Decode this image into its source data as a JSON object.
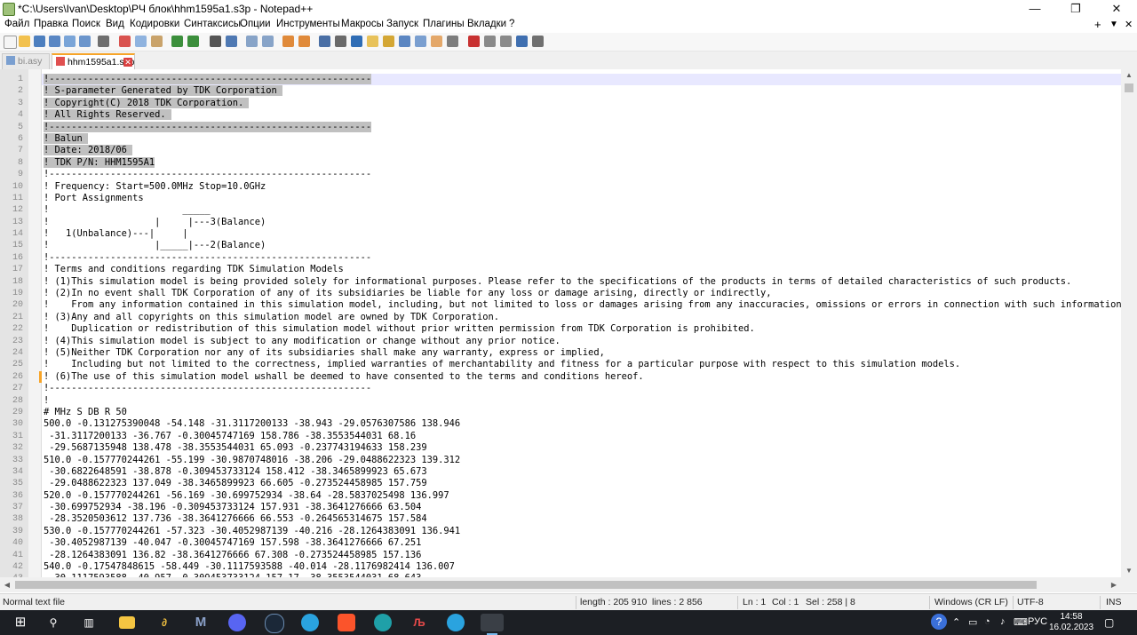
{
  "window": {
    "title": "*C:\\Users\\Ivan\\Desktop\\РЧ блок\\hhm1595a1.s3p - Notepad++",
    "minimize": "—",
    "maximize": "❐",
    "close": "✕"
  },
  "menu": {
    "items": [
      "Файл",
      "Правка",
      "Поиск",
      "Вид",
      "Кодировки",
      "Синтаксисы",
      "Опции",
      "Инструменты",
      "Макросы",
      "Запуск",
      "Плагины",
      "Вкладки",
      "?"
    ],
    "right_plus": "+",
    "right_arrow": "▼",
    "right_close": "✕"
  },
  "tabs": [
    {
      "label": "bi.asy"
    },
    {
      "label": "hhm1595a1.s3p",
      "close": "✕"
    }
  ],
  "editor": {
    "lines": [
      {
        "n": "1",
        "text": "!----------------------------------------------------------",
        "sel": true
      },
      {
        "n": "2",
        "text": "! S-parameter Generated by TDK Corporation ",
        "sel": true
      },
      {
        "n": "3",
        "text": "! Copyright(C) 2018 TDK Corporation. ",
        "sel": true
      },
      {
        "n": "4",
        "text": "! All Rights Reserved. ",
        "sel": true
      },
      {
        "n": "5",
        "text": "!----------------------------------------------------------",
        "sel": true
      },
      {
        "n": "6",
        "text": "! Balun ",
        "sel": true
      },
      {
        "n": "7",
        "text": "! Date: 2018/06 ",
        "sel": true
      },
      {
        "n": "8",
        "text": "! TDK P/N: HHM1595A1",
        "sel": true
      },
      {
        "n": "9",
        "text": "!----------------------------------------------------------"
      },
      {
        "n": "10",
        "text": "! Frequency: Start=500.0MHz Stop=10.0GHz"
      },
      {
        "n": "11",
        "text": "! Port Assignments"
      },
      {
        "n": "12",
        "text": "!                        _____"
      },
      {
        "n": "13",
        "text": "!                   |     |---3(Balance)"
      },
      {
        "n": "14",
        "text": "!   1(Unbalance)---|     |"
      },
      {
        "n": "15",
        "text": "!                   |_____|---2(Balance)"
      },
      {
        "n": "16",
        "text": "!----------------------------------------------------------"
      },
      {
        "n": "17",
        "text": "! Terms and conditions regarding TDK Simulation Models"
      },
      {
        "n": "18",
        "text": "! (1)This simulation model is being provided solely for informational purposes. Please refer to the specifications of the products in terms of detailed characteristics of such products."
      },
      {
        "n": "19",
        "text": "! (2)In no event shall TDK Corporation of any of its subsidiaries be liable for any loss or damage arising, directly or indirectly,"
      },
      {
        "n": "20",
        "text": "!    From any information contained in this simulation model, including, but not limited to loss or damages arising from any inaccuracies, omissions or errors in connection with such information."
      },
      {
        "n": "21",
        "text": "! (3)Any and all copyrights on this simulation model are owned by TDK Corporation."
      },
      {
        "n": "22",
        "text": "!    Duplication or redistribution of this simulation model without prior written permission from TDK Corporation is prohibited."
      },
      {
        "n": "23",
        "text": "! (4)This simulation model is subject to any modification or change without any prior notice."
      },
      {
        "n": "24",
        "text": "! (5)Neither TDK Corporation nor any of its subsidiaries shall make any warranty, express or implied,"
      },
      {
        "n": "25",
        "text": "!    Including but not limited to the correctness, implied warranties of merchantability and fitness for a particular purpose with respect to this simulation models."
      },
      {
        "n": "26",
        "text": "! (6)The use of this simulation model ыshall be deemed to have consented to the terms and conditions hereof.",
        "changed": true
      },
      {
        "n": "27",
        "text": "!----------------------------------------------------------"
      },
      {
        "n": "28",
        "text": "!"
      },
      {
        "n": "29",
        "text": "# MHz S DB R 50"
      },
      {
        "n": "30",
        "text": "500.0 -0.131275390048 -54.148 -31.3117200133 -38.943 -29.0576307586 138.946"
      },
      {
        "n": "31",
        "text": " -31.3117200133 -36.767 -0.30045747169 158.786 -38.3553544031 68.16"
      },
      {
        "n": "32",
        "text": " -29.5687135948 138.478 -38.3553544031 65.093 -0.237743194633 158.239"
      },
      {
        "n": "33",
        "text": "510.0 -0.157770244261 -55.199 -30.9870748016 -38.206 -29.0488622323 139.312"
      },
      {
        "n": "34",
        "text": " -30.6822648591 -38.878 -0.309453733124 158.412 -38.3465899923 65.673"
      },
      {
        "n": "35",
        "text": " -29.0488622323 137.049 -38.3465899923 66.605 -0.273524458985 157.759"
      },
      {
        "n": "36",
        "text": "520.0 -0.157770244261 -56.169 -30.699752934 -38.64 -28.5837025498 136.997"
      },
      {
        "n": "37",
        "text": " -30.699752934 -38.196 -0.309453733124 157.931 -38.3641276666 63.504"
      },
      {
        "n": "38",
        "text": " -28.3520503612 137.736 -38.3641276666 66.553 -0.264565314675 157.584"
      },
      {
        "n": "39",
        "text": "530.0 -0.157770244261 -57.323 -30.4052987139 -40.216 -28.1264383091 136.941"
      },
      {
        "n": "40",
        "text": " -30.4052987139 -40.047 -0.30045747169 157.598 -38.3641276666 67.251"
      },
      {
        "n": "41",
        "text": " -28.1264383091 136.82 -38.3641276666 67.308 -0.273524458985 157.136"
      },
      {
        "n": "42",
        "text": "540.0 -0.17547848615 -58.449 -30.1117593588 -40.014 -28.1176982414 136.007"
      },
      {
        "n": "43",
        "text": " -30.1117593588 -40.957 -0.309453733124 157.17 -38.3553544031 68.643"
      }
    ]
  },
  "status": {
    "filetype": "Normal text file",
    "length": "length : 205 910",
    "lines": "lines : 2 856",
    "ln": "Ln : 1",
    "col": "Col : 1",
    "sel": "Sel : 258 | 8",
    "eol": "Windows (CR LF)",
    "encoding": "UTF-8",
    "mode": "INS"
  },
  "taskbar": {
    "lang": "РУС",
    "time": "14:58",
    "date": "16.02.2023",
    "help": "?"
  },
  "colors": {
    "selection": "#c0c0c0",
    "current_line": "#e8e8ff",
    "tab_accent": "#f7a428",
    "taskbar": "#1c1f24"
  }
}
